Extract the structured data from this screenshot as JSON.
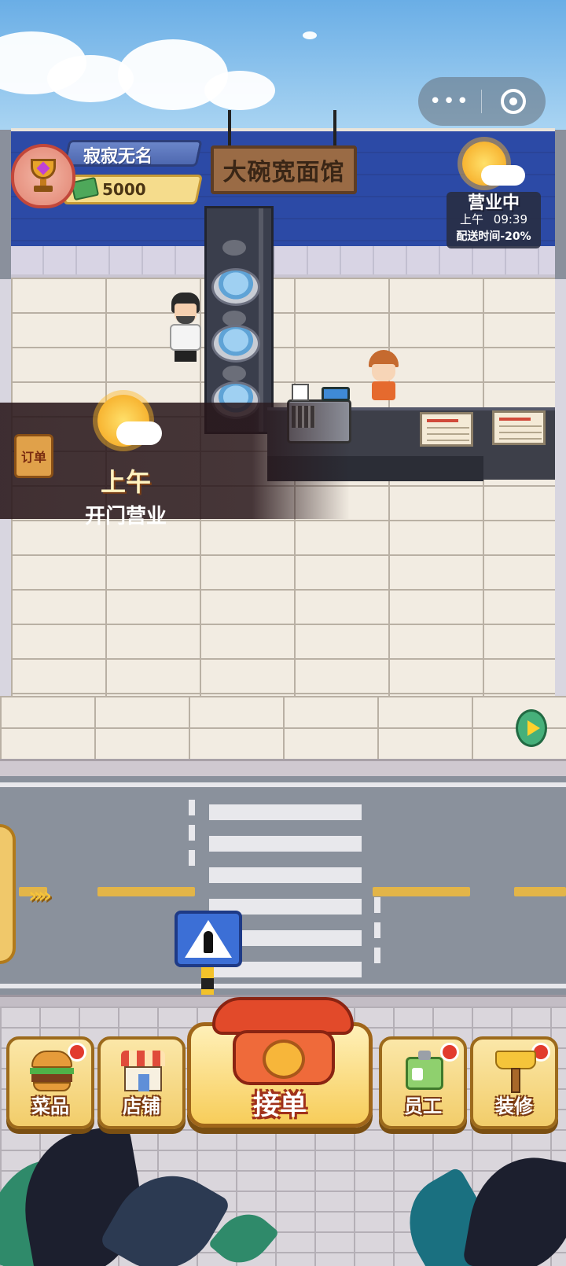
{
  "capsule": {
    "menu_dots": "•••"
  },
  "shop": {
    "name": "大碗宽面馆"
  },
  "player": {
    "name": "寂寂无名",
    "money": "5000"
  },
  "status": {
    "state": "营业中",
    "period": "上午",
    "time": "09:39",
    "bonus": "配送时间-20%"
  },
  "announcement": {
    "period": "上午",
    "message": "开门营业",
    "order_icon_label": "订单"
  },
  "road": {
    "chevrons": "»"
  },
  "bottom_menu": [
    {
      "label": "菜品",
      "icon": "burger-icon",
      "has_dot": true
    },
    {
      "label": "店铺",
      "icon": "shop-icon",
      "has_dot": false
    },
    {
      "label": "接单",
      "icon": "phone-icon",
      "has_dot": false
    },
    {
      "label": "员工",
      "icon": "badge-icon",
      "has_dot": true
    },
    {
      "label": "装修",
      "icon": "brush-icon",
      "has_dot": true
    }
  ],
  "colors": {
    "wall_blue": "#2c4aa6",
    "sky": "#6aaee6",
    "button_gold": "#f2cd6a",
    "notify_red": "#e23b2d",
    "phone_red": "#e24a2a"
  }
}
